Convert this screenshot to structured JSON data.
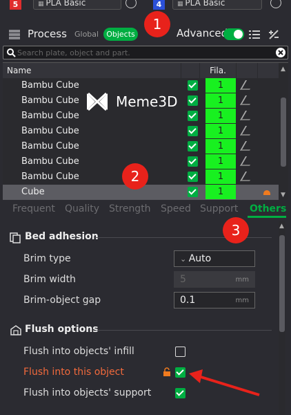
{
  "top_bar": {
    "slot_left_num": "5",
    "slot_left_fila": "PLA Basic",
    "slot_right_num": "4",
    "slot_right_fila": "PLA Basic"
  },
  "process": {
    "title": "Process",
    "global_label": "Global",
    "objects_label": "Objects",
    "advanced_label": "Advanced",
    "advanced_on": true
  },
  "search": {
    "placeholder": "Search plate, object and part."
  },
  "object_list": {
    "col_name": "Name",
    "col_fila": "Fila.",
    "watermark": "Meme3D",
    "rows": [
      {
        "name": "Bambu Cube",
        "fila": "1"
      },
      {
        "name": "Bambu Cube",
        "fila": "1"
      },
      {
        "name": "Bambu Cube",
        "fila": "1"
      },
      {
        "name": "Bambu Cube",
        "fila": "1"
      },
      {
        "name": "Bambu Cube",
        "fila": "1"
      },
      {
        "name": "Bambu Cube",
        "fila": "1"
      },
      {
        "name": "Bambu Cube",
        "fila": "1"
      },
      {
        "name": "Cube",
        "fila": "1"
      }
    ]
  },
  "tabs": [
    "Frequent",
    "Quality",
    "Strength",
    "Speed",
    "Support",
    "Others"
  ],
  "active_tab": "Others",
  "bed_adhesion": {
    "title": "Bed adhesion",
    "brim_type_label": "Brim type",
    "brim_type_value": "Auto",
    "brim_width_label": "Brim width",
    "brim_width_value": "5",
    "brim_width_unit": "mm",
    "brim_gap_label": "Brim-object gap",
    "brim_gap_value": "0.1",
    "brim_gap_unit": "mm"
  },
  "flush_options": {
    "title": "Flush options",
    "infill_label": "Flush into objects' infill",
    "infill_checked": false,
    "object_label": "Flush into this object",
    "object_checked": true,
    "support_label": "Flush into objects' support",
    "support_checked": true
  },
  "callouts": [
    "1",
    "2",
    "3"
  ],
  "colors": {
    "accent_green": "#00ae42",
    "filament_green": "#18f020",
    "callout_red": "#e8221b",
    "warn_orange": "#f26a3c"
  }
}
